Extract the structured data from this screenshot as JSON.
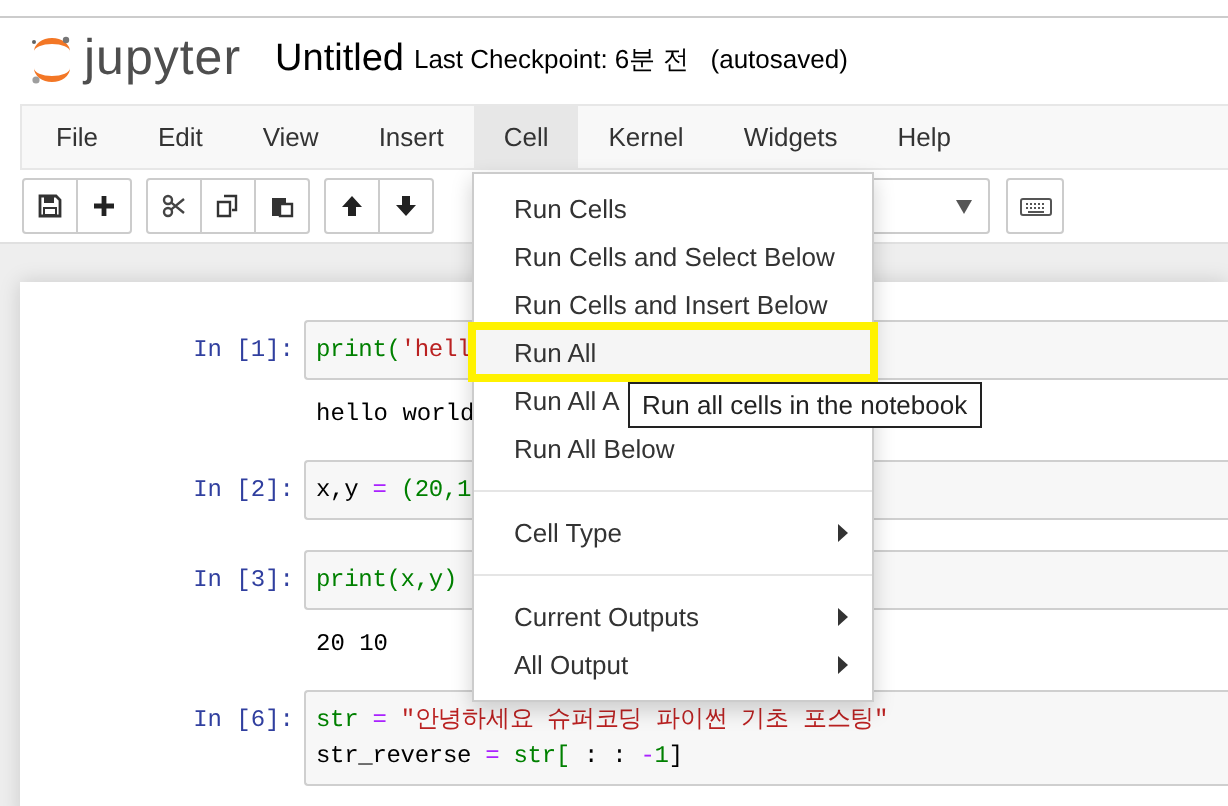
{
  "header": {
    "logo_text": "jupyter",
    "title": "Untitled",
    "checkpoint": "Last Checkpoint: 6분 전",
    "autosave": "(autosaved)"
  },
  "menubar": [
    {
      "label": "File",
      "selected": false
    },
    {
      "label": "Edit",
      "selected": false
    },
    {
      "label": "View",
      "selected": false
    },
    {
      "label": "Insert",
      "selected": false
    },
    {
      "label": "Cell",
      "selected": true
    },
    {
      "label": "Kernel",
      "selected": false
    },
    {
      "label": "Widgets",
      "selected": false
    },
    {
      "label": "Help",
      "selected": false
    }
  ],
  "toolbar": [
    {
      "buttons": [
        {
          "kind": "save"
        },
        {
          "kind": "add"
        }
      ]
    },
    {
      "buttons": [
        {
          "kind": "cut"
        },
        {
          "kind": "copy"
        },
        {
          "kind": "paste"
        }
      ]
    },
    {
      "buttons": [
        {
          "kind": "up"
        },
        {
          "kind": "down"
        }
      ]
    }
  ],
  "cells": [
    {
      "prompt": "In [1]:",
      "code": [
        [
          {
            "kind": "builtin",
            "text": "print("
          },
          {
            "kind": "string",
            "text": "'hell"
          }
        ]
      ],
      "output": "hello world"
    },
    {
      "prompt": "In [2]:",
      "code": [
        [
          {
            "kind": "plain",
            "text": "x,y "
          },
          {
            "kind": "op",
            "text": "="
          },
          {
            "kind": "number",
            "text": " (20,1"
          }
        ]
      ]
    },
    {
      "prompt": "In [3]:",
      "code": [
        [
          {
            "kind": "builtin",
            "text": "print(x,y)"
          }
        ]
      ],
      "output": "20 10"
    },
    {
      "prompt": "In [6]:",
      "code": [
        [
          {
            "kind": "builtin",
            "text": "str"
          },
          {
            "kind": "op",
            "text": " = "
          },
          {
            "kind": "string",
            "text": "\"안녕하세요 슈퍼코딩 파이썬 기초 포스팅\""
          }
        ],
        [
          {
            "kind": "plain",
            "text": "str_reverse "
          },
          {
            "kind": "op",
            "text": "= "
          },
          {
            "kind": "builtin",
            "text": "str["
          },
          {
            "kind": "plain",
            "text": " : : "
          },
          {
            "kind": "op",
            "text": "-"
          },
          {
            "kind": "number",
            "text": "1"
          },
          {
            "kind": "plain",
            "text": "]"
          }
        ]
      ]
    }
  ],
  "cell_menu": [
    {
      "kind": "item",
      "label": "Run Cells",
      "highlighted": false,
      "submenu": false
    },
    {
      "kind": "item",
      "label": "Run Cells and Select Below",
      "highlighted": false,
      "submenu": false
    },
    {
      "kind": "item",
      "label": "Run Cells and Insert Below",
      "highlighted": false,
      "submenu": false
    },
    {
      "kind": "item",
      "label": "Run All",
      "highlighted": true,
      "submenu": false
    },
    {
      "kind": "item",
      "label": "Run All A",
      "highlighted": false,
      "submenu": false
    },
    {
      "kind": "item",
      "label": "Run All Below",
      "highlighted": false,
      "submenu": false
    },
    {
      "kind": "divider"
    },
    {
      "kind": "item",
      "label": "Cell Type",
      "highlighted": false,
      "submenu": true
    },
    {
      "kind": "divider"
    },
    {
      "kind": "item",
      "label": "Current Outputs",
      "highlighted": false,
      "submenu": true
    },
    {
      "kind": "item",
      "label": "All Output",
      "highlighted": false,
      "submenu": true
    }
  ],
  "tooltip": "Run all cells in the notebook"
}
